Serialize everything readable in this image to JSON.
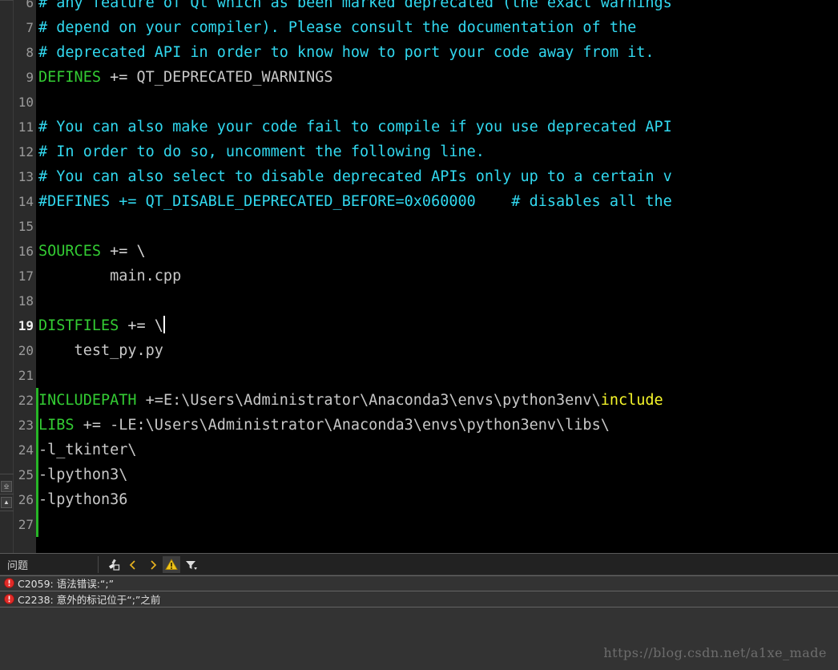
{
  "editor": {
    "first_visible_line": 6,
    "current_line": 19,
    "cursor_line": 19,
    "change_bar_color": "#27b527",
    "background": "#000000",
    "gutter_background": "#2b2b2b",
    "colors": {
      "comment": "#31d8ef",
      "variable": "#33cc33",
      "plain": "#c8c8c8",
      "highlight": "#f7f72a"
    },
    "lines": [
      {
        "no": 6,
        "segments": [
          {
            "t": "# any feature of Qt which as been marked deprecated (the exact warnings",
            "c": "comment"
          }
        ]
      },
      {
        "no": 7,
        "segments": [
          {
            "t": "# depend on your compiler). Please consult the documentation of the",
            "c": "comment"
          }
        ]
      },
      {
        "no": 8,
        "segments": [
          {
            "t": "# deprecated API in order to know how to port your code away from it.",
            "c": "comment"
          }
        ]
      },
      {
        "no": 9,
        "segments": [
          {
            "t": "DEFINES",
            "c": "var"
          },
          {
            "t": " += ",
            "c": "op"
          },
          {
            "t": "QT_DEPRECATED_WARNINGS",
            "c": "plain"
          }
        ]
      },
      {
        "no": 10,
        "segments": []
      },
      {
        "no": 11,
        "segments": [
          {
            "t": "# You can also make your code fail to compile if you use deprecated API",
            "c": "comment"
          }
        ]
      },
      {
        "no": 12,
        "segments": [
          {
            "t": "# In order to do so, uncomment the following line.",
            "c": "comment"
          }
        ]
      },
      {
        "no": 13,
        "segments": [
          {
            "t": "# You can also select to disable deprecated APIs only up to a certain v",
            "c": "comment"
          }
        ]
      },
      {
        "no": 14,
        "segments": [
          {
            "t": "#DEFINES += QT_DISABLE_DEPRECATED_BEFORE=0x060000    # disables all the",
            "c": "comment"
          }
        ]
      },
      {
        "no": 15,
        "segments": []
      },
      {
        "no": 16,
        "segments": [
          {
            "t": "SOURCES",
            "c": "var"
          },
          {
            "t": " += \\",
            "c": "op"
          }
        ]
      },
      {
        "no": 17,
        "segments": [
          {
            "t": "        main.cpp",
            "c": "plain"
          }
        ]
      },
      {
        "no": 18,
        "segments": []
      },
      {
        "no": 19,
        "segments": [
          {
            "t": "DISTFILES",
            "c": "var"
          },
          {
            "t": " += \\",
            "c": "op"
          }
        ],
        "caret": true
      },
      {
        "no": 20,
        "segments": [
          {
            "t": "    test_py.py",
            "c": "plain"
          }
        ]
      },
      {
        "no": 21,
        "segments": []
      },
      {
        "no": 22,
        "segments": [
          {
            "t": "INCLUDEPATH",
            "c": "var"
          },
          {
            "t": " +=E:\\Users\\Administrator\\Anaconda3\\envs\\python3env\\",
            "c": "plain"
          },
          {
            "t": "include",
            "c": "hl"
          }
        ],
        "changed": true
      },
      {
        "no": 23,
        "segments": [
          {
            "t": "LIBS",
            "c": "var"
          },
          {
            "t": " += -LE:\\Users\\Administrator\\Anaconda3\\envs\\python3env\\libs\\",
            "c": "plain"
          }
        ],
        "changed": true
      },
      {
        "no": 24,
        "segments": [
          {
            "t": "-l_tkinter\\",
            "c": "plain"
          }
        ],
        "changed": true
      },
      {
        "no": 25,
        "segments": [
          {
            "t": "-lpython3\\",
            "c": "plain"
          }
        ],
        "changed": true
      },
      {
        "no": 26,
        "segments": [
          {
            "t": "-lpython36",
            "c": "plain"
          }
        ],
        "changed": true
      },
      {
        "no": 27,
        "segments": [],
        "changed": true
      }
    ]
  },
  "panel": {
    "tab_label": "问题",
    "toolbar": [
      {
        "name": "clear-brush-icon",
        "title": ""
      },
      {
        "name": "chevron-left-icon",
        "title": ""
      },
      {
        "name": "chevron-right-icon",
        "title": ""
      },
      {
        "name": "warning-triangle-icon",
        "title": ""
      },
      {
        "name": "filter-icon",
        "title": ""
      }
    ],
    "issues": [
      {
        "severity": "error",
        "text": "C2059: 语法错误:“;”"
      },
      {
        "severity": "error",
        "text": "C2238: 意外的标记位于“;”之前"
      }
    ]
  },
  "watermark": {
    "text": "https://blog.csdn.net/a1xe_made"
  }
}
